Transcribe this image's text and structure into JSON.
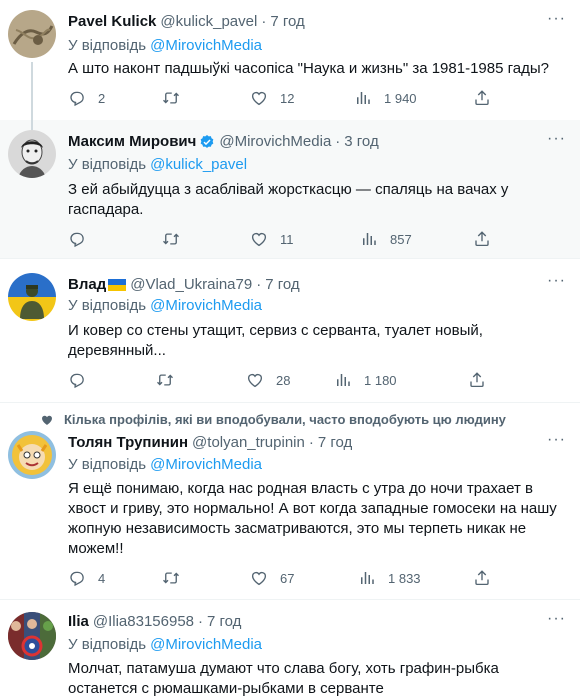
{
  "tweets": [
    {
      "name": "Pavel Kulick",
      "handle": "@kulick_pavel",
      "time": "7 год",
      "reply_prefix": "У відповідь",
      "reply_to": "@MirovichMedia",
      "text": "А што наконт падшыўкі часопіса \"Наука и жизнь\" за 1981-1985 гады?",
      "replies": "2",
      "retweets": "",
      "likes": "12",
      "views": "1 940"
    },
    {
      "name": "Максим Мирович",
      "handle": "@MirovichMedia",
      "time": "3 год",
      "reply_prefix": "У відповідь",
      "reply_to": "@kulick_pavel",
      "text": "З ей абыйдуцца з асаблівай жорсткасцю — спаляць на вачах у гаспадара.",
      "replies": "",
      "retweets": "",
      "likes": "11",
      "views": "857"
    },
    {
      "name": "Влад",
      "handle": "@Vlad_Ukraina79",
      "time": "7 год",
      "reply_prefix": "У відповідь",
      "reply_to": "@MirovichMedia",
      "text": "И ковер со стены утащит, сервиз с серванта, туалет новый, деревянный...",
      "replies": "",
      "retweets": "",
      "likes": "28",
      "views": "1 180"
    },
    {
      "social_context": "Кілька профілів, які ви вподобували, часто вподобують цю людину",
      "name": "Толян Трупинин",
      "handle": "@tolyan_trupinin",
      "time": "7 год",
      "reply_prefix": "У відповідь",
      "reply_to": "@MirovichMedia",
      "text": "Я ещё понимаю, когда нас родная власть с утра до ночи трахает в хвост и гриву, это нормально! А вот когда западные гомосеки на нашу жопную независимость засматриваются, это мы терпеть никак не можем!!",
      "replies": "4",
      "retweets": "",
      "likes": "67",
      "views": "1 833"
    },
    {
      "name": "Ilia",
      "handle": "@Ilia83156958",
      "time": "7 год",
      "reply_prefix": "У відповідь",
      "reply_to": "@MirovichMedia",
      "text": "Молчат, патамуша думают что слава богу,  хоть графин-рыбка останется с рюмашками-рыбками в серванте"
    }
  ],
  "more_label": "···",
  "colors": {
    "accent": "#1d9bf0",
    "secondary": "#536471",
    "highlight_bg": "#f7f9f9"
  }
}
